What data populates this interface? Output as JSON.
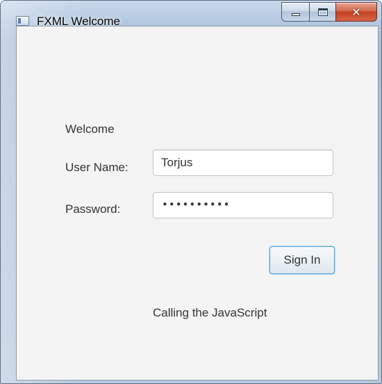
{
  "window": {
    "title": "FXML Welcome",
    "controls": {
      "minimize": "minimize",
      "maximize": "maximize",
      "close": "close"
    }
  },
  "form": {
    "welcome": "Welcome",
    "username_label": "User Name:",
    "username_value": "Torjus",
    "password_label": "Password:",
    "password_value": "••••••••••",
    "signin_label": "Sign In",
    "message": "Calling the JavaScript"
  },
  "colors": {
    "accent_focus": "#4e9ed6",
    "close_button": "#c4401f",
    "client_background": "#f4f4f4"
  }
}
